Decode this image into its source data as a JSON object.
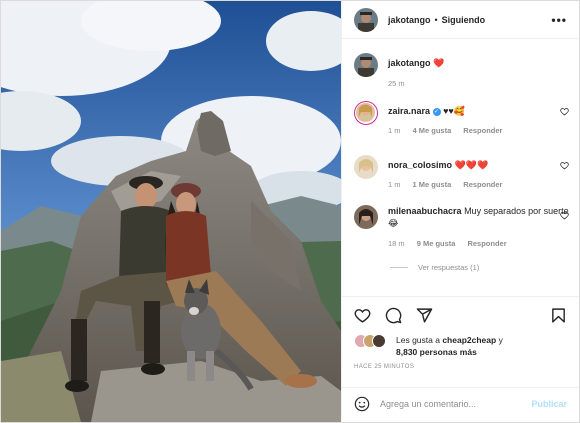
{
  "header": {
    "username": "jakotango",
    "separator": "•",
    "follow_label": "Siguiendo",
    "more_label": "•••"
  },
  "caption": {
    "username": "jakotango",
    "text": "❤️",
    "time": "25 m"
  },
  "comments": [
    {
      "username": "zaira.nara",
      "verified": true,
      "text": "♥♥🥰",
      "time": "1 m",
      "likes": "4 Me gusta",
      "reply": "Responder"
    },
    {
      "username": "nora_colosimo",
      "text": "❤️❤️❤️",
      "time": "1 m",
      "likes": "1 Me gusta",
      "reply": "Responder"
    },
    {
      "username": "milenaabuchacra",
      "text": "Muy separados por suerte😂",
      "time": "18 m",
      "likes": "9 Me gusta",
      "reply": "Responder",
      "view_replies": "Ver respuestas (1)"
    }
  ],
  "likes": {
    "prefix": "Les gusta a",
    "user": "cheap2cheap",
    "connector": "y",
    "others": "8,830 personas más"
  },
  "timestamp": "HACE 25 MINUTOS",
  "add_comment": {
    "placeholder": "Agrega un comentario...",
    "publish": "Publicar"
  },
  "colors": {
    "publish": "#b2dffc",
    "heart": "#ed4956",
    "verified": "#3897f0"
  }
}
